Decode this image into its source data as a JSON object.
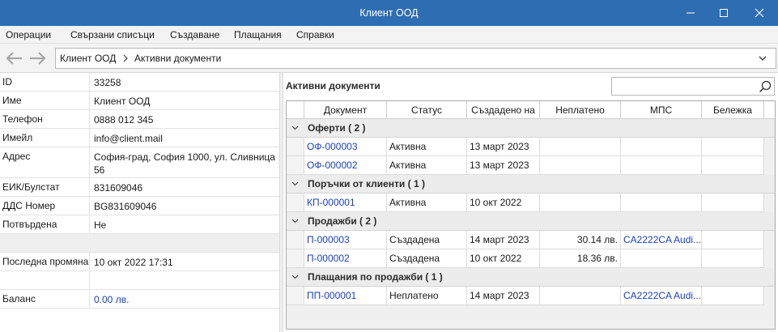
{
  "window": {
    "title": "Клиент ООД",
    "accent": "#2f6db3"
  },
  "menu": [
    "Операции",
    "Свързани списъци",
    "Създаване",
    "Плащания",
    "Справки"
  ],
  "breadcrumb": {
    "root": "Клиент ООД",
    "current": "Активни документи"
  },
  "properties": [
    {
      "label": "ID",
      "value": "33258"
    },
    {
      "label": "Име",
      "value": "Клиент ООД"
    },
    {
      "label": "Телефон",
      "value": "0888 012 345"
    },
    {
      "label": "Имейл",
      "value": "info@client.mail"
    },
    {
      "label": "Адрес",
      "value": "София-град, София 1000, ул. Сливница 56"
    },
    {
      "label": "ЕИК/Булстат",
      "value": "831609046"
    },
    {
      "label": "ДДС Номер",
      "value": "BG831609046"
    },
    {
      "label": "Потвърдена",
      "value": "Не"
    },
    {
      "label": "",
      "value": ""
    },
    {
      "label": "Последна промяна",
      "value": "10 окт 2022 17:31"
    },
    {
      "label": "",
      "value": ""
    },
    {
      "label": "Баланс",
      "value": "0.00 лв."
    }
  ],
  "documents": {
    "title": "Активни документи",
    "search": {
      "placeholder": ""
    },
    "columns": [
      "Документ",
      "Статус",
      "Създадено на",
      "Неплатено",
      "МПС",
      "Бележка"
    ],
    "groups": [
      {
        "label": "Оферти ( 2 )",
        "rows": [
          {
            "doc": "ОФ-000003",
            "status": "Активна",
            "created": "13 март 2023",
            "unpaid": "",
            "vehicle": "",
            "note": ""
          },
          {
            "doc": "ОФ-000002",
            "status": "Активна",
            "created": "13 март 2023",
            "unpaid": "",
            "vehicle": "",
            "note": ""
          }
        ]
      },
      {
        "label": "Поръчки от клиенти ( 1 )",
        "rows": [
          {
            "doc": "КП-000001",
            "status": "Активна",
            "created": "10 окт 2022",
            "unpaid": "",
            "vehicle": "",
            "note": ""
          }
        ]
      },
      {
        "label": "Продажби ( 2 )",
        "rows": [
          {
            "doc": "П-000003",
            "status": "Създадена",
            "created": "14 март 2023",
            "unpaid": "30.14 лв.",
            "vehicle": "CA2222CA Audi...",
            "note": ""
          },
          {
            "doc": "П-000002",
            "status": "Създадена",
            "created": "10 окт 2022",
            "unpaid": "18.36 лв.",
            "vehicle": "",
            "note": ""
          }
        ]
      },
      {
        "label": "Плащания по продажби ( 1 )",
        "rows": [
          {
            "doc": "ПП-000001",
            "status": "Неплатено",
            "created": "14 март 2023",
            "unpaid": "",
            "vehicle": "CA2222CA Audi...",
            "note": ""
          }
        ]
      }
    ]
  },
  "colors": {
    "link": "#1a3fc4"
  }
}
